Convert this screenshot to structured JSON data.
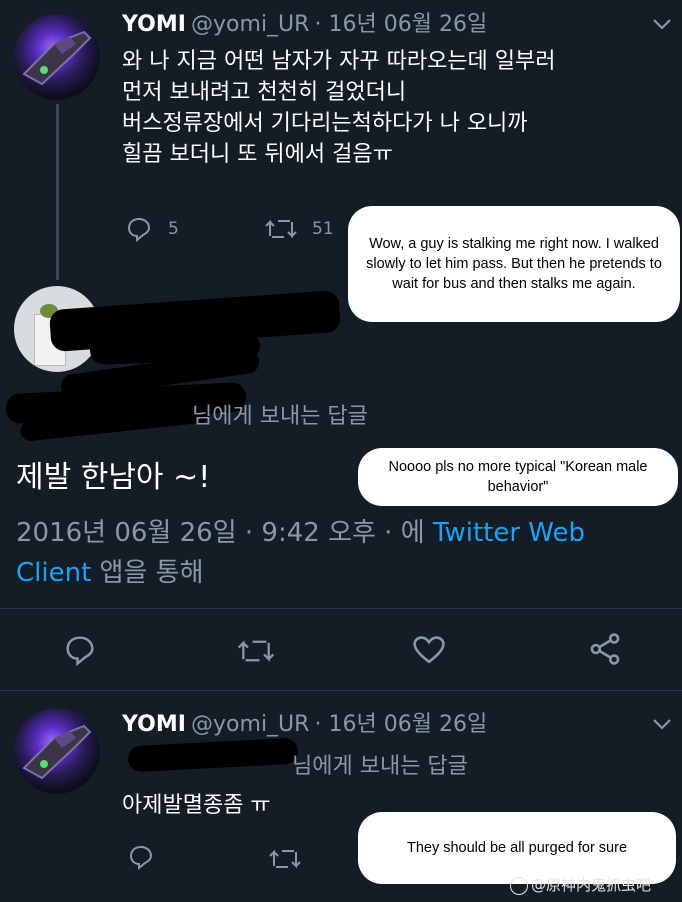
{
  "tweet1": {
    "name": "YOMI",
    "handle": "@yomi_UR",
    "date": "· 16년 06월 26일",
    "text": "와 나 지금 어떤 남자가 자꾸 따라오는데 일부러\n먼저 보내려고 천천히 걸었더니\n버스정류장에서 기다리는척하다가 나 오니까\n힐끔 보더니 또 뒤에서 걸음ㅠ",
    "replies": "5",
    "retweets": "51"
  },
  "reply_main": {
    "reply_to": "님에게 보내는 답글",
    "text": "제발 한남아 ~!",
    "timestamp": "2016년 06월 26일 · 9:42 오후 · 에",
    "client_link": "Twitter Web",
    "client_link2": "Client",
    "client_suffix": "앱을 통해"
  },
  "tweet3": {
    "name": "YOMI",
    "handle": "@yomi_UR",
    "date": "· 16년 06월 26일",
    "reply_to": "님에게 보내는 답글",
    "text": "아제발멸종좀 ㅠ"
  },
  "captions": {
    "caption1": "Wow, a guy is stalking me right now. I walked slowly to let him pass. But then he pretends to wait for bus and then stalks me again.",
    "caption2": "Noooo pls no more typical \"Korean male behavior\"",
    "caption3": "They should be all purged for sure"
  },
  "watermark": "@原神内鬼抓虫吧",
  "icons": {
    "reply": "reply-icon",
    "retweet": "retweet-icon",
    "like": "heart-icon",
    "share": "share-icon",
    "chevron": "chevron-down-icon"
  },
  "colors": {
    "background": "#141d26",
    "muted": "#8899a6",
    "link": "#1da1f2"
  }
}
